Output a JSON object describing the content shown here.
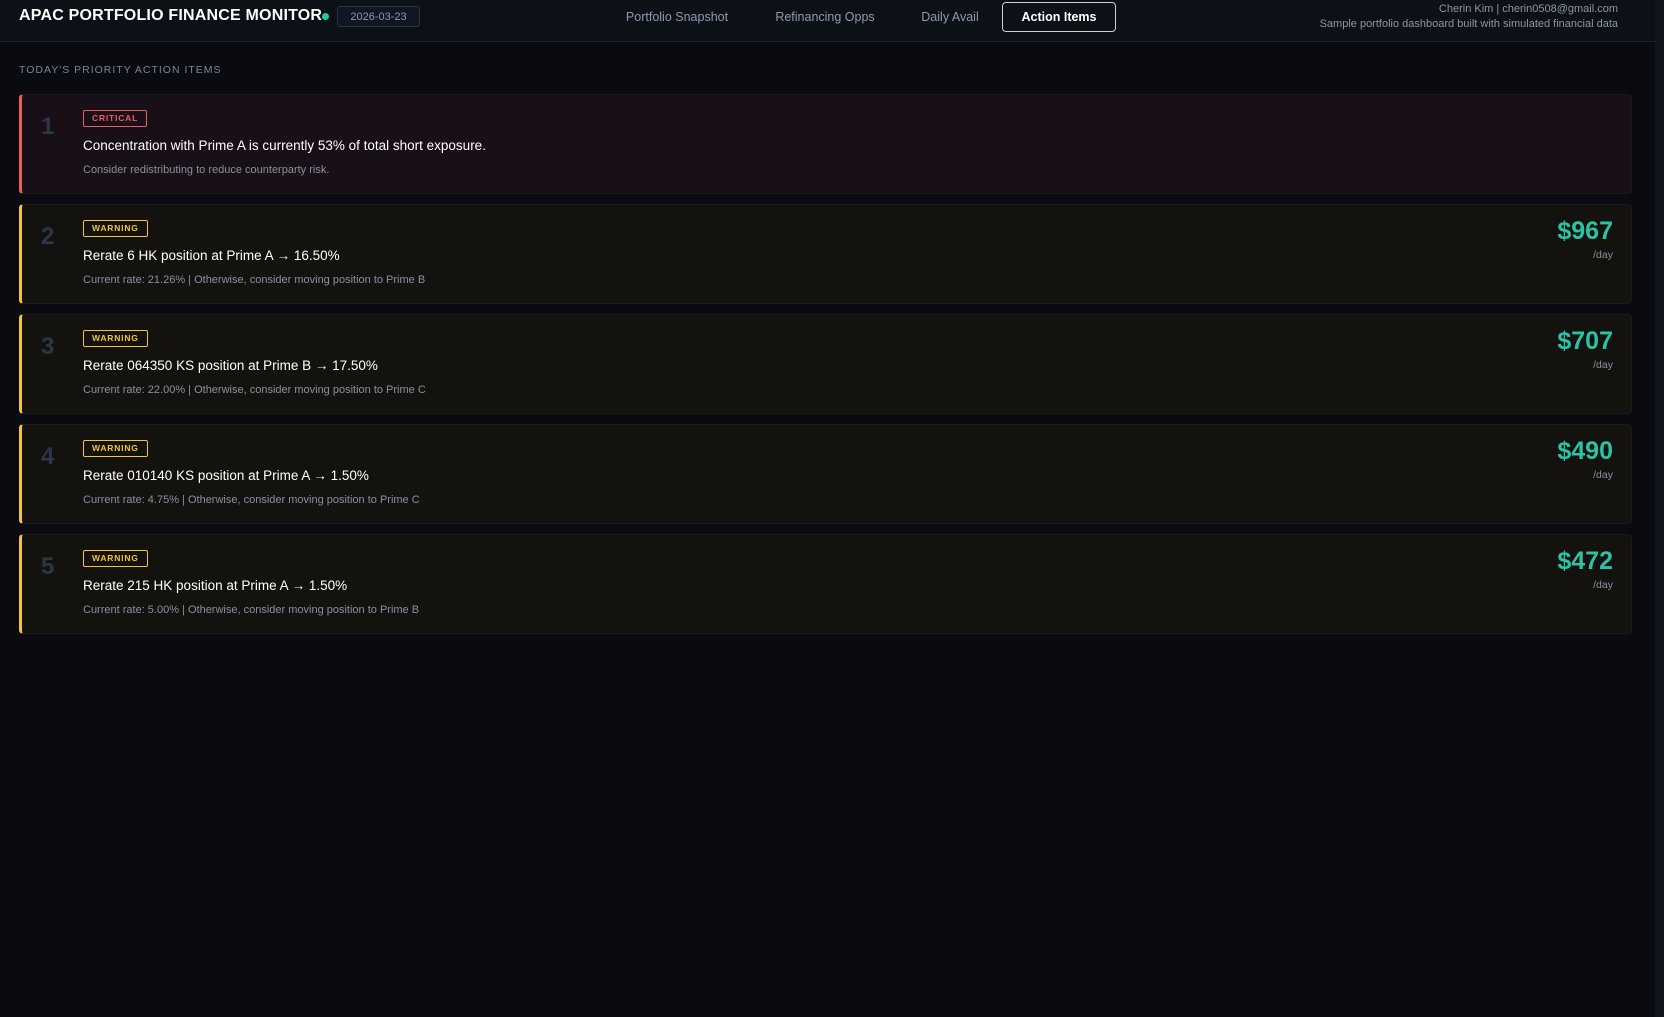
{
  "header": {
    "app_title": "APAC PORTFOLIO FINANCE MONITOR",
    "date": "2026-03-23",
    "tabs": [
      {
        "label": "Portfolio Snapshot",
        "active": false
      },
      {
        "label": "Refinancing Opps",
        "active": false
      },
      {
        "label": "Daily Avail",
        "active": false
      },
      {
        "label": "Action Items",
        "active": true
      }
    ],
    "author": "Cherin Kim | cherin0508@gmail.com",
    "disclaimer": "Sample portfolio dashboard built with simulated financial data"
  },
  "colors": {
    "critical": "#ef5a65",
    "warning": "#f2c33d",
    "savings": "#2cc2a6",
    "live_indicator": "#2cc2a6"
  },
  "section": {
    "title": "TODAY'S PRIORITY ACTION ITEMS"
  },
  "items": [
    {
      "number": "1",
      "severity": "CRITICAL",
      "title": "Concentration with Prime A is currently 53% of total short exposure.",
      "detail": "Consider redistributing to reduce counterparty risk.",
      "amount": "",
      "unit": ""
    },
    {
      "number": "2",
      "severity": "WARNING",
      "title": "Rerate 6 HK position at Prime A → 16.50%",
      "detail": "Current rate: 21.26% | Otherwise, consider moving position to Prime B",
      "amount": "$967",
      "unit": "/day"
    },
    {
      "number": "3",
      "severity": "WARNING",
      "title": "Rerate 064350 KS position at Prime B → 17.50%",
      "detail": "Current rate: 22.00% | Otherwise, consider moving position to Prime C",
      "amount": "$707",
      "unit": "/day"
    },
    {
      "number": "4",
      "severity": "WARNING",
      "title": "Rerate 010140 KS position at Prime A → 1.50%",
      "detail": "Current rate: 4.75% | Otherwise, consider moving position to Prime C",
      "amount": "$490",
      "unit": "/day"
    },
    {
      "number": "5",
      "severity": "WARNING",
      "title": "Rerate 215 HK position at Prime A → 1.50%",
      "detail": "Current rate: 5.00% | Otherwise, consider moving position to Prime B",
      "amount": "$472",
      "unit": "/day"
    }
  ]
}
